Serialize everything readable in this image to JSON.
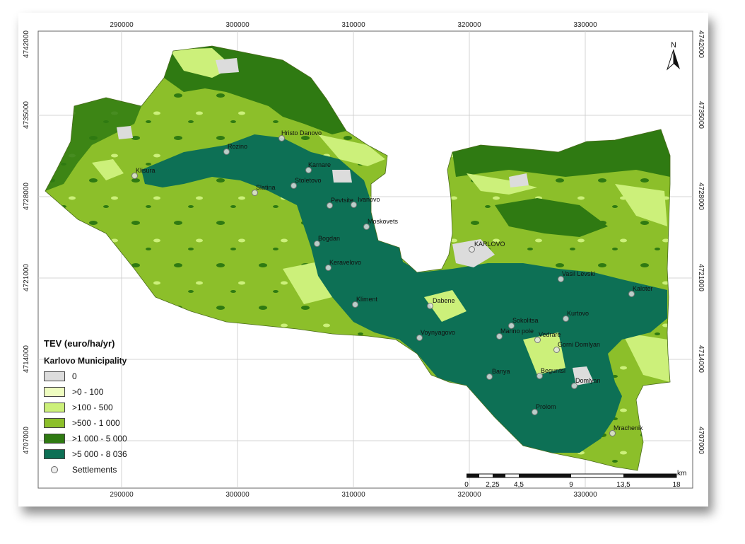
{
  "axes": {
    "x_ticks": [
      "290000",
      "300000",
      "310000",
      "320000",
      "330000"
    ],
    "y_ticks": [
      "4742000",
      "4735000",
      "4728000",
      "4721000",
      "4714000",
      "4707000"
    ]
  },
  "legend": {
    "title": "TEV (euro/ha/yr)",
    "subtitle": "Karlovo Municipality",
    "classes": [
      {
        "label": "0",
        "color": "#dcdcdc"
      },
      {
        "label": ">0 - 100",
        "color": "#eefcc0"
      },
      {
        "label": ">100 - 500",
        "color": "#ccf07a"
      },
      {
        "label": ">500 - 1 000",
        "color": "#8cbf2a"
      },
      {
        "label": ">1 000 - 5 000",
        "color": "#2f7a12"
      },
      {
        "label": ">5 000 - 8 036",
        "color": "#0d7055"
      }
    ],
    "settlements_label": "Settlements"
  },
  "settlements": [
    {
      "name": "Hristo Danovo"
    },
    {
      "name": "Rozino"
    },
    {
      "name": "Karnare"
    },
    {
      "name": "Klisura"
    },
    {
      "name": "Stoletovo"
    },
    {
      "name": "Slatina"
    },
    {
      "name": "Pevtsite"
    },
    {
      "name": "Ivanovo"
    },
    {
      "name": "Moskovets"
    },
    {
      "name": "Bogdan"
    },
    {
      "name": "KARLOVO"
    },
    {
      "name": "Keravelovo"
    },
    {
      "name": "Vasil Levski"
    },
    {
      "name": "Kaloter"
    },
    {
      "name": "Kliment"
    },
    {
      "name": "Dabene"
    },
    {
      "name": "Sokolitsa"
    },
    {
      "name": "Kurtovo"
    },
    {
      "name": "Marino pole"
    },
    {
      "name": "Vedrare"
    },
    {
      "name": "Voynyagovo"
    },
    {
      "name": "Gorni Domlyan"
    },
    {
      "name": "Banya"
    },
    {
      "name": "Beguntsi"
    },
    {
      "name": "Domlyan"
    },
    {
      "name": "Prolom"
    },
    {
      "name": "Mrachenik"
    }
  ],
  "north_arrow": {
    "label": "N"
  },
  "scale_bar": {
    "unit": "km",
    "labels": [
      "0",
      "2,25",
      "4,5",
      "9",
      "13,5",
      "18"
    ]
  }
}
